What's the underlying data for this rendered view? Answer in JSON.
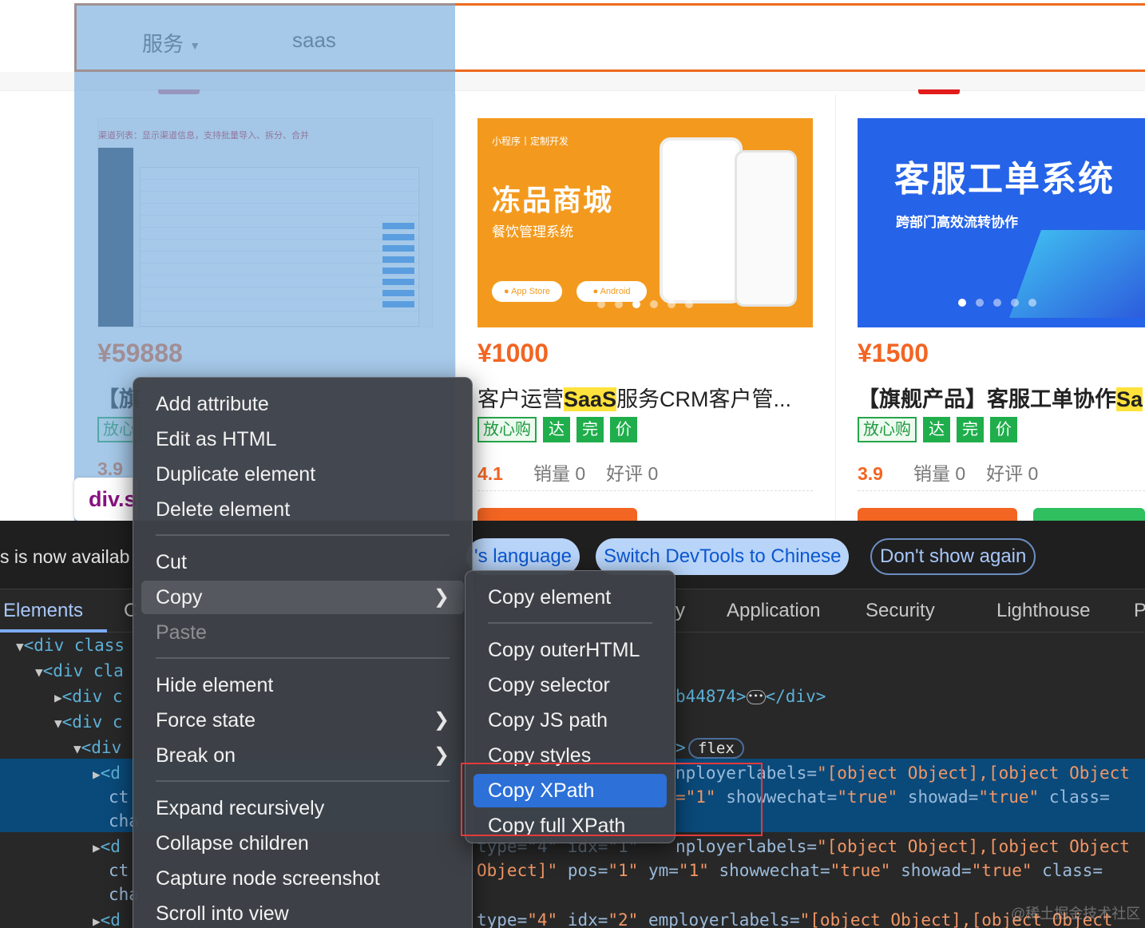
{
  "nav": {
    "services_label": "服务",
    "saas_label": "saas"
  },
  "cards": [
    {
      "price": "¥59888",
      "title_prefix": "【旗",
      "tag_first": "放心",
      "rating": "3.9",
      "element_label": "div.s",
      "screen_caption": "渠道列表：显示渠道信息，支持批量导入、拆分、合并"
    },
    {
      "price": "¥1000",
      "title_before": "客户运营",
      "title_highlight": "SaaS",
      "title_after": "服务CRM客户管...",
      "tags": [
        "放心购",
        "达",
        "完",
        "价"
      ],
      "rating": "4.1",
      "sales_label": "销量 0",
      "reviews_label": "好评 0",
      "banner": {
        "top_text": "小程序丨定制开发",
        "headline": "冻品商城",
        "subline": "餐饮管理系统",
        "appstore": "App Store",
        "android": "Android",
        "bg_color": "#f39a1e"
      }
    },
    {
      "price": "¥1500",
      "title_before": "【旗舰产品】客服工单协作",
      "title_highlight": "Sa",
      "tags": [
        "放心购",
        "达",
        "完",
        "价"
      ],
      "rating": "3.9",
      "sales_label": "销量 0",
      "reviews_label": "好评 0",
      "banner": {
        "headline": "客服工单系统",
        "subline": "跨部门高效流转协作",
        "bg_color": "#2563e8"
      }
    }
  ],
  "devtools": {
    "info_text": "s is now availab",
    "lang_pill": "'s language",
    "switch_pill": "Switch DevTools to Chinese",
    "dont_show_pill": "Don't show again",
    "tabs": {
      "elements": "Elements",
      "console_stub": "C",
      "memory_stub": "y",
      "application": "Application",
      "security": "Security",
      "lighthouse": "Lighthouse",
      "more_stub": "P"
    },
    "code": {
      "l1": "<div class",
      "l2": "<div cla",
      "l3": "<div c",
      "l4": "<div c",
      "l5": "<div",
      "l6": "<d",
      "l6b": "ct",
      "l6c": "cha",
      "l7": "<d",
      "l7b": "ct",
      "l7c": "cha",
      "l8": "<d",
      "r1_id": "b44874>",
      "r1_close": "</div>",
      "flex_badge": "flex",
      "ellipsis": "•••",
      "sel_line1_attr": "nployerlabels=",
      "sel_line1_val": "\"[object Object],[object Object",
      "sel_line2_pre": "=\"1\"",
      "sel_line2_attr1": "showwechat=",
      "sel_line2_val1": "\"true\"",
      "sel_line2_attr2": "showad=",
      "sel_line2_val2": "\"true\"",
      "sel_line2_attr3": "class=",
      "l7_attr": "nployerlabels=",
      "l7_val": "\"[object Object],[object Object",
      "l7_stub": "type=\"4\" idx=\"1\"",
      "l7b_val0": "Object]\"",
      "l7b_attr1": "pos=",
      "l7b_val1": "\"1\"",
      "l7b_attr2": "ym=",
      "l7b_val2": "\"1\"",
      "l7b_attr3": "showwechat=",
      "l7b_val3": "\"true\"",
      "l7b_attr4": "showad=",
      "l7b_val4": "\"true\"",
      "l7b_attr5": "class=",
      "l8_attr1": "type=",
      "l8_val1": "\"4\"",
      "l8_attr2": "idx=",
      "l8_val2": "\"2\"",
      "l8_attr3": "employerlabels=",
      "l8_val3": "\"[object Object],[object Object"
    },
    "watermark": "@稀土掘金技术社区"
  },
  "context_menu": {
    "items": {
      "add_attribute": "Add attribute",
      "edit_as_html": "Edit as HTML",
      "duplicate_element": "Duplicate element",
      "delete_element": "Delete element",
      "cut": "Cut",
      "copy": "Copy",
      "paste": "Paste",
      "hide_element": "Hide element",
      "force_state": "Force state",
      "break_on": "Break on",
      "expand_recursively": "Expand recursively",
      "collapse_children": "Collapse children",
      "capture_node_screenshot": "Capture node screenshot",
      "scroll_into_view": "Scroll into view"
    }
  },
  "copy_submenu": {
    "items": {
      "copy_element": "Copy element",
      "copy_outerhtml": "Copy outerHTML",
      "copy_selector": "Copy selector",
      "copy_js_path": "Copy JS path",
      "copy_styles": "Copy styles",
      "copy_xpath": "Copy XPath",
      "copy_full_xpath": "Copy full XPath"
    }
  },
  "icons": {
    "dropdown": "caret-down-icon",
    "submenu": "chevron-right-icon",
    "expand": "triangle-right-icon",
    "collapse": "triangle-down-icon"
  }
}
